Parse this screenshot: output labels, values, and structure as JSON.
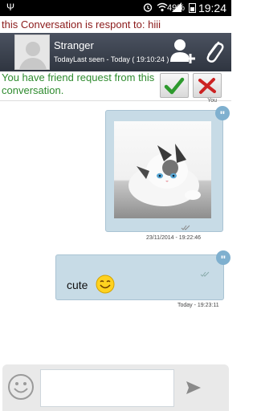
{
  "status_bar": {
    "battery": "49%",
    "time": "19:24"
  },
  "conversation_note": "this Conversation is respont to: hiii",
  "header": {
    "name": "Stranger",
    "last_seen": "TodayLast seen - Today ( 19:10:24 )"
  },
  "friend_request": {
    "text": "You have friend request from this conversation."
  },
  "sender_label": "You",
  "messages": [
    {
      "type": "image",
      "timestamp": "23/11/2014 - 19:22:46"
    },
    {
      "type": "text",
      "text": "cute",
      "timestamp": "Today - 19:23:11"
    }
  ],
  "composer": {
    "placeholder": ""
  },
  "icons": [
    "usb-icon",
    "alarm-icon",
    "wifi-icon",
    "signal-icon",
    "battery-icon",
    "avatar",
    "add-user-icon",
    "attach-icon",
    "check-icon",
    "close-icon",
    "quote-icon",
    "double-check-icon",
    "smile-emoji",
    "emoji-icon",
    "send-icon"
  ],
  "colors": {
    "header": "#3a404b",
    "bubble": "#c7dbe6",
    "friend_text": "#2e8b2e",
    "note_text": "#8b1a1a"
  }
}
